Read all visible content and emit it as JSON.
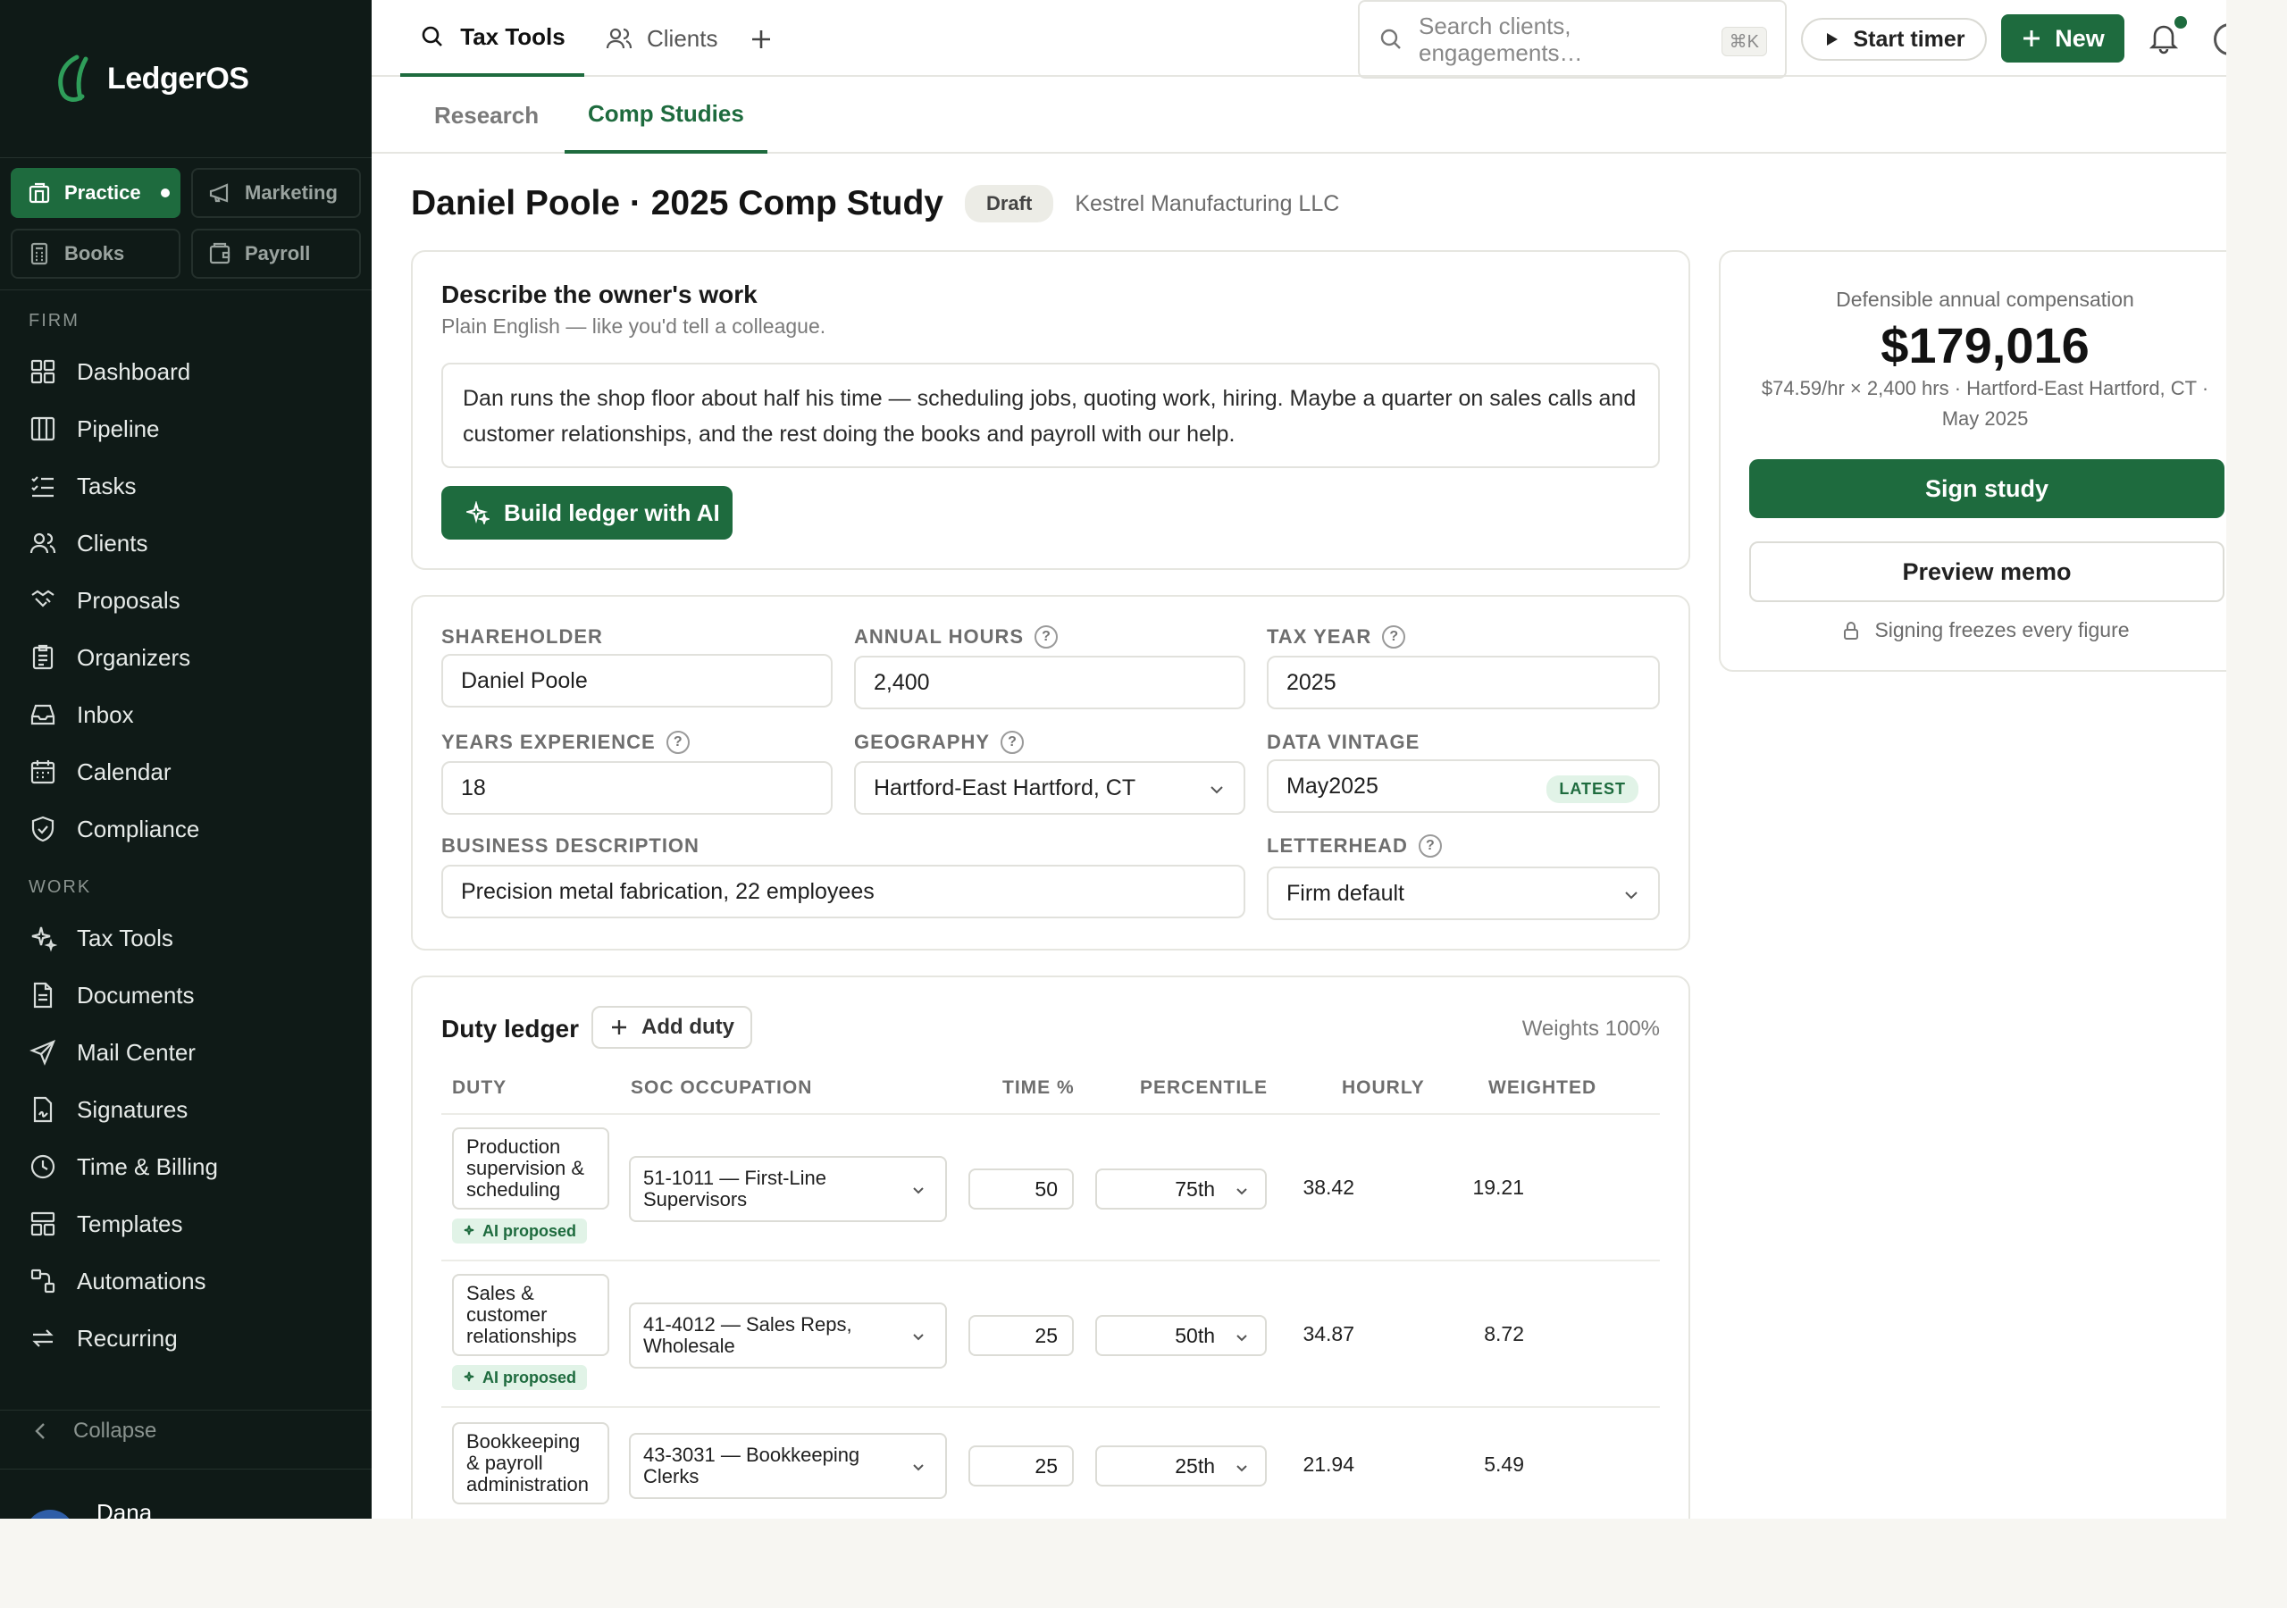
{
  "brand": {
    "name": "LedgerOS",
    "accent": "#1e6b3e",
    "sidebar_bg": "#0f1a17"
  },
  "workspaces": [
    {
      "label": "Practice",
      "icon": "building-icon",
      "active": true
    },
    {
      "label": "Marketing",
      "icon": "megaphone-icon",
      "active": false
    },
    {
      "label": "Books",
      "icon": "calculator-icon",
      "active": false
    },
    {
      "label": "Payroll",
      "icon": "wallet-icon",
      "active": false
    }
  ],
  "sidebar": {
    "firm_label": "FIRM",
    "firm_items": [
      "Dashboard",
      "Pipeline",
      "Tasks",
      "Clients",
      "Proposals",
      "Organizers",
      "Inbox",
      "Calendar",
      "Compliance"
    ],
    "work_label": "WORK",
    "work_items": [
      "Tax Tools",
      "Documents",
      "Mail Center",
      "Signatures",
      "Time & Billing",
      "Templates",
      "Automations",
      "Recurring"
    ],
    "collapse_label": "Collapse",
    "user_name": "Dana"
  },
  "topbar": {
    "tabs": [
      "Tax Tools",
      "Clients"
    ],
    "search_placeholder": "Search clients, engagements…",
    "search_shortcut": "⌘K",
    "timer_label": "Start timer",
    "new_label": "New"
  },
  "subtabs": [
    "Research",
    "Comp Studies"
  ],
  "page": {
    "title": "Daniel Poole · 2025 Comp Study",
    "status": "Draft",
    "client": "Kestrel Manufacturing LLC"
  },
  "describe": {
    "heading": "Describe the owner's work",
    "subheading": "Plain English — like you'd tell a colleague.",
    "text": "Dan runs the shop floor about half his time — scheduling jobs, quoting work, hiring. Maybe a quarter on sales calls and customer relationships, and the rest doing the books and payroll with our help.",
    "button": "Build ledger with AI"
  },
  "form": {
    "shareholder_label": "SHAREHOLDER",
    "shareholder": "Daniel Poole",
    "hours_label": "ANNUAL HOURS",
    "hours": "2,400",
    "year_label": "TAX YEAR",
    "year": "2025",
    "experience_label": "YEARS EXPERIENCE",
    "experience": "18",
    "geo_label": "GEOGRAPHY",
    "geo": "Hartford-East Hartford, CT",
    "vintage_label": "DATA VINTAGE",
    "vintage": "May2025",
    "vintage_badge": "LATEST",
    "business_label": "BUSINESS DESCRIPTION",
    "business": "Precision metal fabrication, 22 employees",
    "letterhead_label": "LETTERHEAD",
    "letterhead": "Firm default",
    "help_glyph": "?"
  },
  "ledger": {
    "title": "Duty ledger",
    "add_label": "Add duty",
    "weights": "Weights 100%",
    "ai_badge": "AI proposed",
    "columns": [
      "DUTY",
      "SOC OCCUPATION",
      "TIME %",
      "PERCENTILE",
      "HOURLY",
      "WEIGHTED"
    ],
    "rows": [
      {
        "duty": "Production supervision & scheduling",
        "soc": "51-1011 — First-Line Supervisors",
        "time": "50",
        "percentile": "75th",
        "hourly": "38.42",
        "weighted": "19.21",
        "ai": true
      },
      {
        "duty": "Sales & customer relationships",
        "soc": "41-4012 — Sales Reps, Wholesale",
        "time": "25",
        "percentile": "50th",
        "hourly": "34.87",
        "weighted": "8.72",
        "ai": true
      },
      {
        "duty": "Bookkeeping & payroll administration",
        "soc": "43-3031 — Bookkeeping Clerks",
        "time": "25",
        "percentile": "25th",
        "hourly": "21.94",
        "weighted": "5.49",
        "ai": false
      }
    ]
  },
  "summary": {
    "label": "Defensible annual compensation",
    "amount": "$179,016",
    "detail": "$74.59/hr × 2,400 hrs · Hartford-East Hartford, CT · May 2025",
    "sign_label": "Sign study",
    "memo_label": "Preview memo",
    "freeze_note": "Signing freezes every figure"
  }
}
